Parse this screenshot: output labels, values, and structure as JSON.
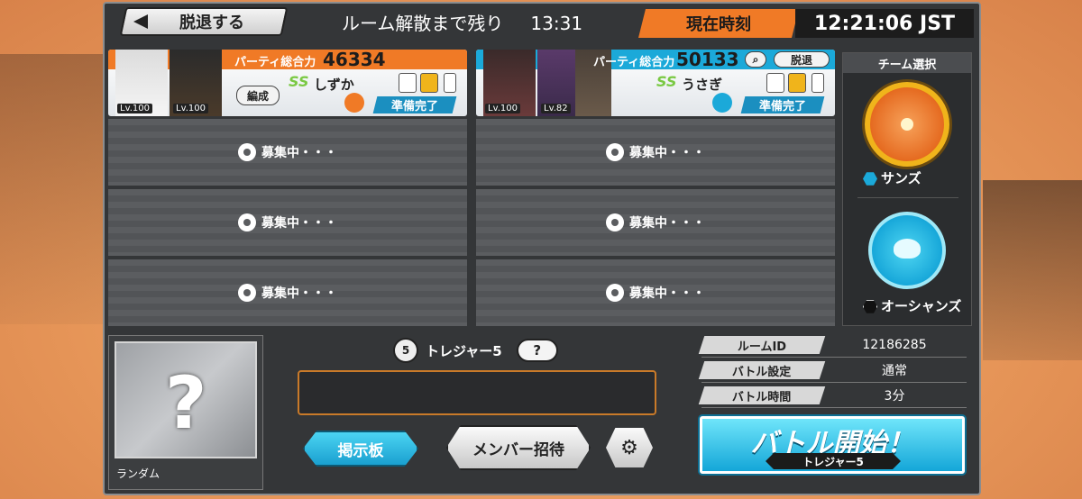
{
  "header": {
    "back_label": "脱退する",
    "dissolve_label": "ルーム解散まで残り",
    "dissolve_time": "13:31",
    "clock_label": "現在時刻",
    "clock_time": "12:21:06 JST"
  },
  "players": [
    {
      "power_label": "パーティ総合力",
      "power": "46334",
      "name": "しずか",
      "level_1": "Lv.100",
      "level_2": "Lv.100",
      "edit_label": "編成",
      "ready": "準備完了",
      "team": "sun",
      "accent": "#f07a26"
    },
    {
      "power_label": "パーティ総合力",
      "power": "50133",
      "name": "うさぎ",
      "level_1": "Lv.100",
      "level_2": "Lv.82",
      "kick_label": "脱退",
      "ready": "準備完了",
      "team": "ocean",
      "accent": "#1ba9d9"
    }
  ],
  "slots": [
    "募集中・・・",
    "募集中・・・",
    "募集中・・・",
    "募集中・・・",
    "募集中・・・",
    "募集中・・・"
  ],
  "team_select": {
    "title": "チーム選択",
    "sun_name": "サンズ",
    "ocean_name": "オーシャンズ"
  },
  "random": {
    "label": "ランダム",
    "mark": "?"
  },
  "mode": {
    "name": "トレジャー5",
    "icon_text": "5",
    "help": "?"
  },
  "buttons": {
    "board": "掲示板",
    "invite": "メンバー招待",
    "gear_icon": "gear-icon"
  },
  "info": [
    {
      "label": "ルームID",
      "value": "12186285"
    },
    {
      "label": "バトル設定",
      "value": "通常"
    },
    {
      "label": "バトル時間",
      "value": "3分"
    }
  ],
  "start": {
    "label": "バトル開始！",
    "sub": "トレジャー5"
  },
  "colors": {
    "orange": "#f07a26",
    "blue": "#1ba9d9",
    "panel": "#343638"
  }
}
